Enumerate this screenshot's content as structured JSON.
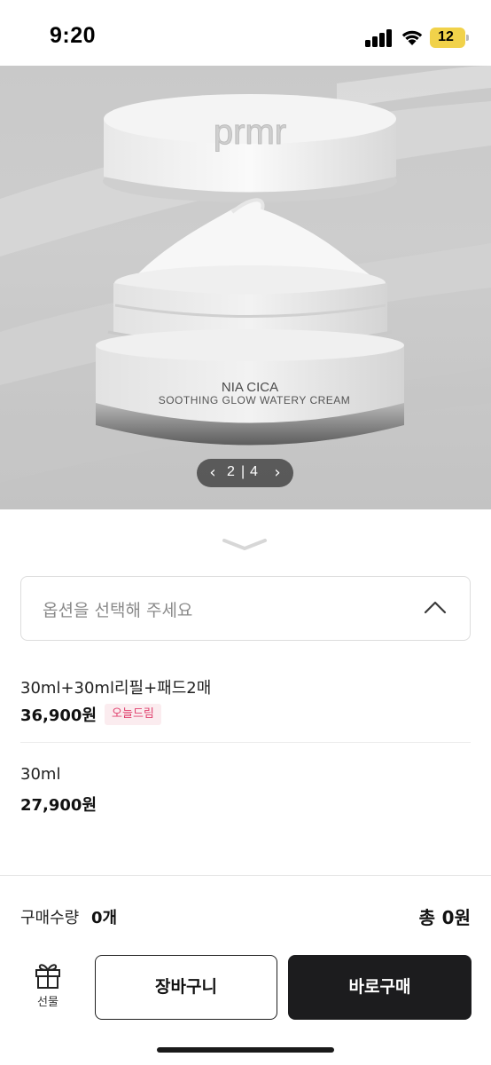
{
  "status_bar": {
    "time": "9:20",
    "battery_level": "12",
    "icons": [
      "cellular-signal-icon",
      "wifi-icon",
      "battery-icon"
    ],
    "battery_color": "#f1d24a"
  },
  "product_image": {
    "brand_mark": "prmr",
    "product_line": "NIA CICA",
    "product_subtitle": "SOOTHING GLOW WATERY CREAM",
    "pager": {
      "current": "2",
      "separator": "|",
      "total": "4",
      "prev_icon": "chevron-left-icon",
      "next_icon": "chevron-right-icon"
    }
  },
  "option_sheet": {
    "select_placeholder": "옵션을 선택해 주세요",
    "options": [
      {
        "name": "30ml+30ml리필+패드2매",
        "price": "36,900원",
        "badge": "오늘드림"
      },
      {
        "name": "30ml",
        "price": "27,900원"
      }
    ],
    "quantity_label": "구매수량",
    "quantity_value": "0개",
    "total_label": "총",
    "total_value": "0원",
    "gift_label": "선물",
    "cart_button": "장바구니",
    "buy_button": "바로구매"
  },
  "colors": {
    "badge_bg": "#fbecef",
    "badge_text": "#e0416e",
    "buy_button_bg": "#1c1c1e"
  }
}
